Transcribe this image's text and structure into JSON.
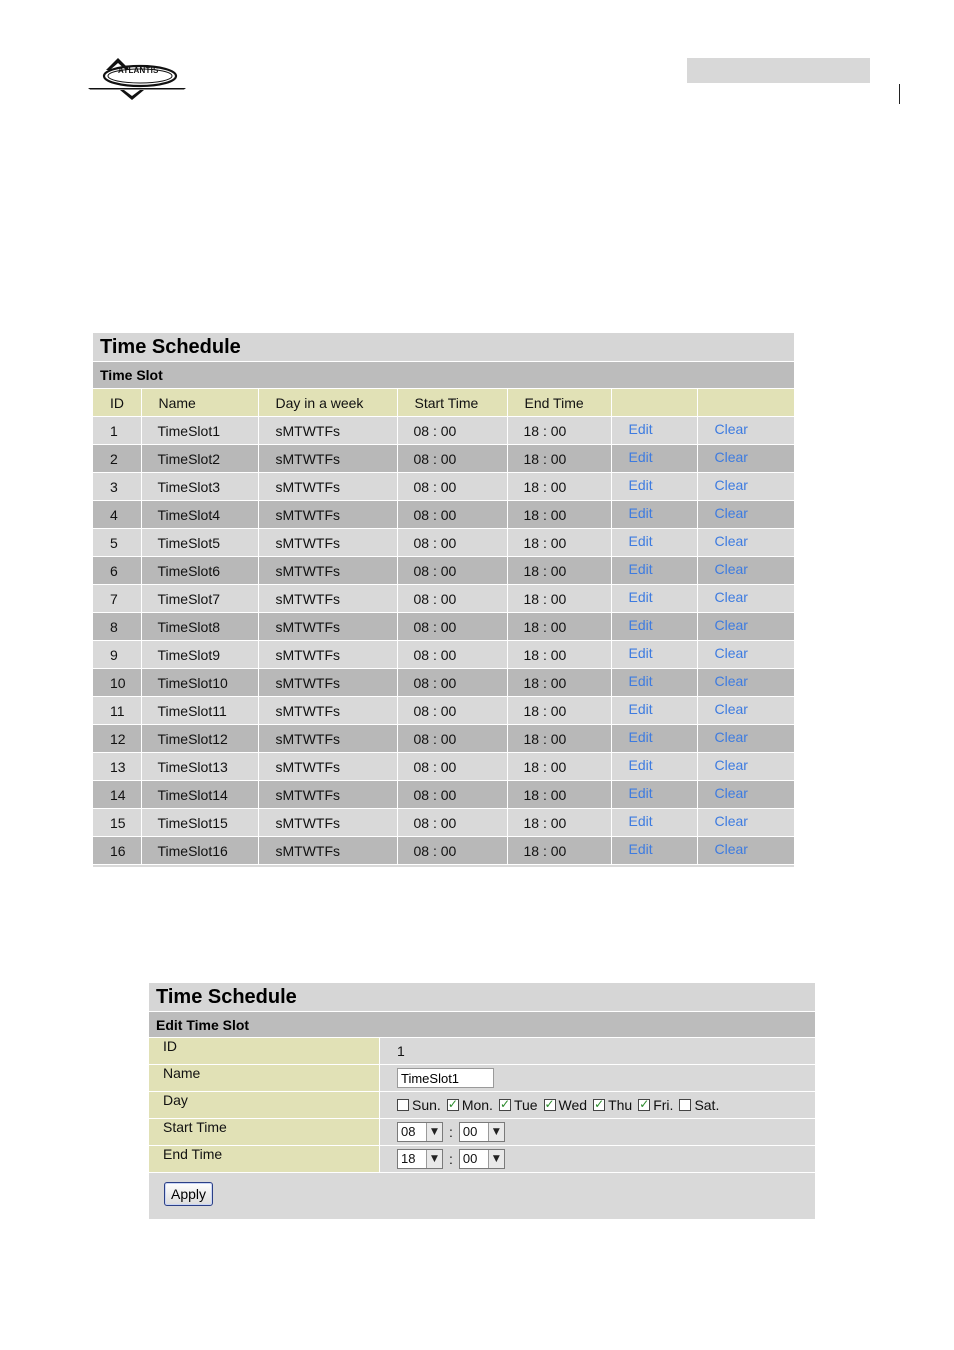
{
  "header": {
    "logo_text": "ATLANTIS"
  },
  "time_slot_panel": {
    "title": "Time Schedule",
    "subtitle": "Time Slot",
    "columns": [
      "ID",
      "Name",
      "Day in a week",
      "Start Time",
      "End Time",
      "",
      ""
    ],
    "rows": [
      {
        "id": "1",
        "name": "TimeSlot1",
        "days": "sMTWTFs",
        "start": "08 : 00",
        "end": "18 : 00",
        "edit": "Edit",
        "clear": "Clear"
      },
      {
        "id": "2",
        "name": "TimeSlot2",
        "days": "sMTWTFs",
        "start": "08 : 00",
        "end": "18 : 00",
        "edit": "Edit",
        "clear": "Clear"
      },
      {
        "id": "3",
        "name": "TimeSlot3",
        "days": "sMTWTFs",
        "start": "08 : 00",
        "end": "18 : 00",
        "edit": "Edit",
        "clear": "Clear"
      },
      {
        "id": "4",
        "name": "TimeSlot4",
        "days": "sMTWTFs",
        "start": "08 : 00",
        "end": "18 : 00",
        "edit": "Edit",
        "clear": "Clear"
      },
      {
        "id": "5",
        "name": "TimeSlot5",
        "days": "sMTWTFs",
        "start": "08 : 00",
        "end": "18 : 00",
        "edit": "Edit",
        "clear": "Clear"
      },
      {
        "id": "6",
        "name": "TimeSlot6",
        "days": "sMTWTFs",
        "start": "08 : 00",
        "end": "18 : 00",
        "edit": "Edit",
        "clear": "Clear"
      },
      {
        "id": "7",
        "name": "TimeSlot7",
        "days": "sMTWTFs",
        "start": "08 : 00",
        "end": "18 : 00",
        "edit": "Edit",
        "clear": "Clear"
      },
      {
        "id": "8",
        "name": "TimeSlot8",
        "days": "sMTWTFs",
        "start": "08 : 00",
        "end": "18 : 00",
        "edit": "Edit",
        "clear": "Clear"
      },
      {
        "id": "9",
        "name": "TimeSlot9",
        "days": "sMTWTFs",
        "start": "08 : 00",
        "end": "18 : 00",
        "edit": "Edit",
        "clear": "Clear"
      },
      {
        "id": "10",
        "name": "TimeSlot10",
        "days": "sMTWTFs",
        "start": "08 : 00",
        "end": "18 : 00",
        "edit": "Edit",
        "clear": "Clear"
      },
      {
        "id": "11",
        "name": "TimeSlot11",
        "days": "sMTWTFs",
        "start": "08 : 00",
        "end": "18 : 00",
        "edit": "Edit",
        "clear": "Clear"
      },
      {
        "id": "12",
        "name": "TimeSlot12",
        "days": "sMTWTFs",
        "start": "08 : 00",
        "end": "18 : 00",
        "edit": "Edit",
        "clear": "Clear"
      },
      {
        "id": "13",
        "name": "TimeSlot13",
        "days": "sMTWTFs",
        "start": "08 : 00",
        "end": "18 : 00",
        "edit": "Edit",
        "clear": "Clear"
      },
      {
        "id": "14",
        "name": "TimeSlot14",
        "days": "sMTWTFs",
        "start": "08 : 00",
        "end": "18 : 00",
        "edit": "Edit",
        "clear": "Clear"
      },
      {
        "id": "15",
        "name": "TimeSlot15",
        "days": "sMTWTFs",
        "start": "08 : 00",
        "end": "18 : 00",
        "edit": "Edit",
        "clear": "Clear"
      },
      {
        "id": "16",
        "name": "TimeSlot16",
        "days": "sMTWTFs",
        "start": "08 : 00",
        "end": "18 : 00",
        "edit": "Edit",
        "clear": "Clear"
      }
    ]
  },
  "edit_panel": {
    "title": "Time Schedule",
    "subtitle": "Edit Time Slot",
    "id_label": "ID",
    "id_value": "1",
    "name_label": "Name",
    "name_value": "TimeSlot1",
    "day_label": "Day",
    "days": [
      {
        "label": "Sun.",
        "checked": false
      },
      {
        "label": "Mon.",
        "checked": true
      },
      {
        "label": "Tue",
        "checked": true
      },
      {
        "label": "Wed",
        "checked": true
      },
      {
        "label": "Thu",
        "checked": true
      },
      {
        "label": "Fri.",
        "checked": true
      },
      {
        "label": "Sat.",
        "checked": false
      }
    ],
    "start_label": "Start Time",
    "start_hour": "08",
    "start_minute": "00",
    "end_label": "End Time",
    "end_hour": "18",
    "end_minute": "00",
    "time_separator": ":",
    "apply_label": "Apply"
  }
}
